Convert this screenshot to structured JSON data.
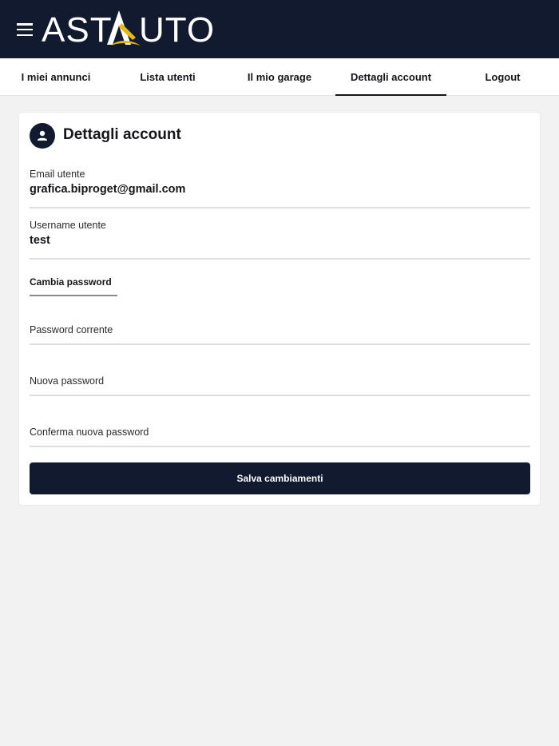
{
  "header": {
    "logo_text": "ASTAUTO",
    "menu_icon": "hamburger-menu-icon",
    "background_color": "#111a2e",
    "accent_color": "#e6b815"
  },
  "tabs": [
    {
      "label": "I miei annunci",
      "active": false
    },
    {
      "label": "Lista utenti",
      "active": false
    },
    {
      "label": "Il mio garage",
      "active": false
    },
    {
      "label": "Dettagli account",
      "active": true
    },
    {
      "label": "Logout",
      "active": false
    }
  ],
  "account": {
    "title": "Dettagli account",
    "icon": "user-icon",
    "email_label": "Email utente",
    "email_value": "grafica.biproget@gmail.com",
    "username_label": "Username utente",
    "username_value": "test"
  },
  "password_section": {
    "tab_label": "Cambia password",
    "current_placeholder": "Password corrente",
    "new_placeholder": "Nuova password",
    "confirm_placeholder": "Conferma nuova password"
  },
  "save_button_label": "Salva cambiamenti"
}
